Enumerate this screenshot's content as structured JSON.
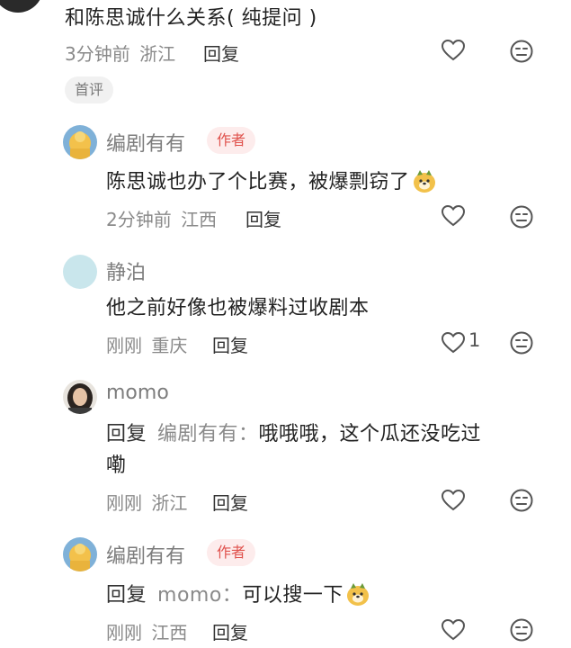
{
  "comments": [
    {
      "text": "和陈思诚什么关系(  纯提问  )",
      "time": "3分钟前",
      "location": "浙江",
      "reply_label": "回复",
      "tag": "首评"
    },
    {
      "author": "编剧有有",
      "badge": "作者",
      "text": "陈思诚也办了个比赛，被爆剽窃了",
      "emoji": "dog-emoji",
      "time": "2分钟前",
      "location": "江西",
      "reply_label": "回复"
    },
    {
      "author": "静泊",
      "text": "他之前好像也被爆料过收剧本",
      "time": "刚刚",
      "location": "重庆",
      "reply_label": "回复",
      "likes": "1"
    },
    {
      "author": "momo",
      "reply_prefix": "回复",
      "reply_to": "编剧有有",
      "text_line1": "哦哦哦，这个瓜还没吃过",
      "text_line2": "嘞",
      "time": "刚刚",
      "location": "浙江",
      "reply_label": "回复"
    },
    {
      "author": "编剧有有",
      "badge": "作者",
      "reply_prefix": "回复",
      "reply_to": "momo",
      "text": "可以搜一下",
      "emoji": "dog-emoji",
      "time": "刚刚",
      "location": "江西",
      "reply_label": "回复"
    }
  ],
  "icons": {
    "like": "heart-outline-icon",
    "dislike": "neutral-face-icon"
  },
  "colors": {
    "author_badge_bg": "#fdecec",
    "author_badge_text": "#e0524d",
    "text": "#222222",
    "meta": "#8a8a8a"
  }
}
